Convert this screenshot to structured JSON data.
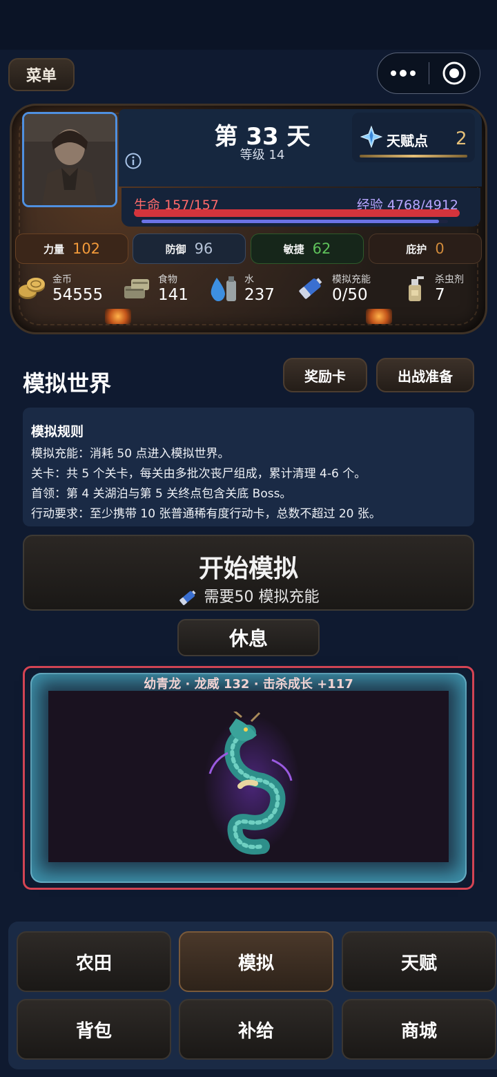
{
  "header": {
    "menu_label": "菜单",
    "more_icon": "more-dots-icon",
    "close_icon": "target-circle-icon"
  },
  "status": {
    "day": "第 33 天",
    "level": "等级 14",
    "talent_label": "天赋点",
    "talent_value": "2",
    "hp_label": "生命 157/157",
    "hp_fraction": 1.0,
    "xp_label": "经验 4768/4912",
    "xp_fraction": 0.971
  },
  "stats": [
    {
      "label": "力量",
      "value": "102",
      "color": "#f39a3a",
      "border": "#6a4224",
      "bg": "#3b2619"
    },
    {
      "label": "防御",
      "value": "96",
      "color": "#b5c2d6",
      "border": "#3a4a62",
      "bg": "#1b2637"
    },
    {
      "label": "敏捷",
      "value": "62",
      "color": "#5fc25b",
      "border": "#2e5a2a",
      "bg": "#16261a"
    },
    {
      "label": "庇护",
      "value": "0",
      "color": "#d08a3a",
      "border": "#4e3828",
      "bg": "#2a1e18"
    }
  ],
  "resources": [
    {
      "label": "金币",
      "value": "54555",
      "icon": "coins-icon"
    },
    {
      "label": "食物",
      "value": "141",
      "icon": "food-crate-icon"
    },
    {
      "label": "水",
      "value": "237",
      "icon": "water-icon"
    },
    {
      "label": "模拟充能",
      "value": "0/50",
      "icon": "battery-icon"
    },
    {
      "label": "杀虫剂",
      "value": "7",
      "icon": "spray-bottle-icon"
    }
  ],
  "sim": {
    "title": "模拟世界",
    "reward_label": "奖励卡",
    "prepare_label": "出战准备",
    "rules_title": "模拟规则",
    "rules": [
      "模拟充能：消耗 50 点进入模拟世界。",
      "关卡：共 5 个关卡，每关由多批次丧尸组成，累计清理 4-6 个。",
      "首领：第 4 关湖泊与第 5 关终点包含关底 Boss。",
      "行动要求：至少携带 10 张普通稀有度行动卡，总数不超过 20 张。"
    ],
    "start_label": "开始模拟",
    "start_sub": "需要50 模拟充能",
    "rest_label": "休息",
    "boss_caption": "幼青龙 · 龙威 132 · 击杀成长 +117"
  },
  "nav": [
    {
      "label": "农田",
      "active": false
    },
    {
      "label": "模拟",
      "active": true
    },
    {
      "label": "天赋",
      "active": false
    },
    {
      "label": "背包",
      "active": false
    },
    {
      "label": "补给",
      "active": false
    },
    {
      "label": "商城",
      "active": false
    }
  ]
}
